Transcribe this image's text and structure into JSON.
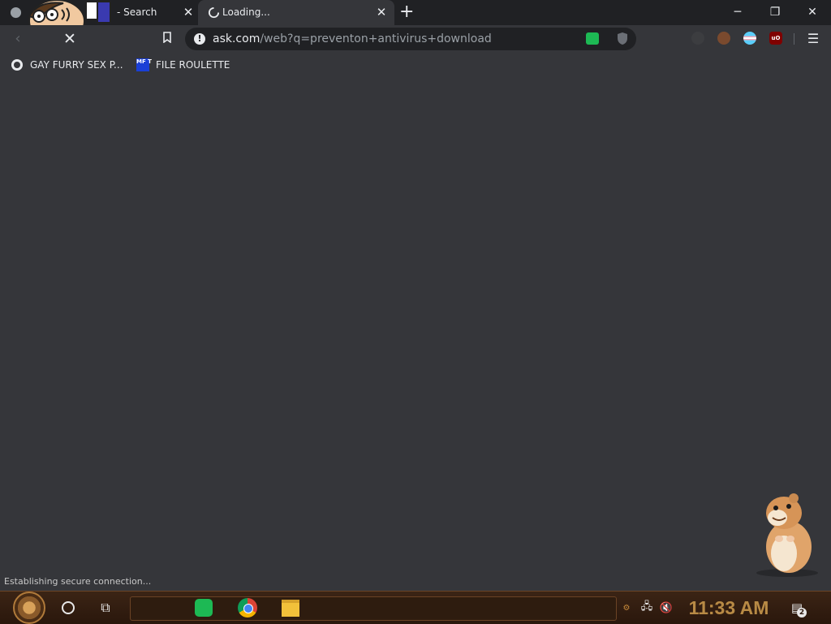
{
  "window": {
    "tabs": [
      {
        "title": "- Search",
        "active": false
      },
      {
        "title": "Loading...",
        "active": true
      }
    ],
    "new_tab_icon": "plus-icon",
    "controls": {
      "minimize": "─",
      "maximize": "❐",
      "close": "✕"
    }
  },
  "toolbar": {
    "url_host": "ask.com",
    "url_rest": "/web?q=preventon+antivirus+download",
    "menu_icon": "vertical-dots-icon"
  },
  "bookmarks": [
    {
      "label": "GAY FURRY SEX P...",
      "icon": "globe-icon"
    },
    {
      "label": "FILE ROULETTE",
      "icon": "mft-icon",
      "icon_text": "MF T"
    }
  ],
  "status": {
    "text": "Establishing secure connection..."
  },
  "taskbar": {
    "clock": "11:33 AM",
    "notification_count": "2",
    "apps": [
      "spotify",
      "chrome",
      "file-explorer"
    ]
  },
  "colors": {
    "chrome_dark": "#202124",
    "chrome_surface": "#35363a",
    "taskbar_brown": "#2a170c",
    "clock_gold": "#b88a45",
    "spotify_green": "#1db954"
  }
}
